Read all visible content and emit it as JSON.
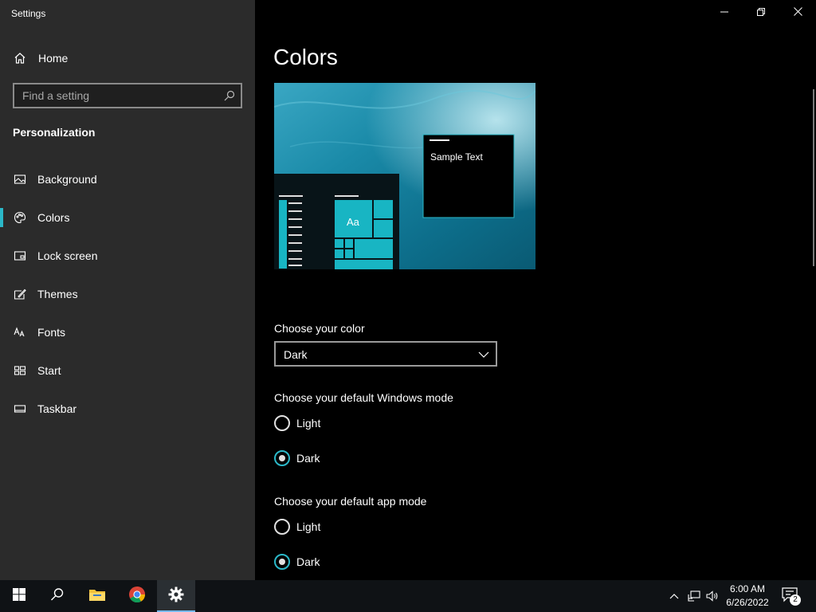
{
  "window": {
    "app_title": "Settings"
  },
  "sidebar": {
    "home_label": "Home",
    "search_placeholder": "Find a setting",
    "section_heading": "Personalization",
    "items": [
      {
        "label": "Background",
        "icon": "picture-icon"
      },
      {
        "label": "Colors",
        "icon": "palette-icon",
        "selected": true
      },
      {
        "label": "Lock screen",
        "icon": "lock-screen-icon"
      },
      {
        "label": "Themes",
        "icon": "themes-icon"
      },
      {
        "label": "Fonts",
        "icon": "fonts-icon"
      },
      {
        "label": "Start",
        "icon": "start-icon"
      },
      {
        "label": "Taskbar",
        "icon": "taskbar-icon"
      }
    ]
  },
  "main": {
    "page_title": "Colors",
    "preview": {
      "sample_text": "Sample Text",
      "tile_text": "Aa"
    },
    "choose_color": {
      "label": "Choose your color",
      "value": "Dark"
    },
    "windows_mode": {
      "label": "Choose your default Windows mode",
      "options": [
        "Light",
        "Dark"
      ],
      "selected": "Dark"
    },
    "app_mode": {
      "label": "Choose your default app mode",
      "options": [
        "Light",
        "Dark"
      ],
      "selected": "Dark"
    }
  },
  "taskbar": {
    "time": "6:00 AM",
    "date": "6/26/2022",
    "notification_count": "2"
  },
  "colors": {
    "accent": "#2bb8c8",
    "sidebar_bg": "#2b2b2b",
    "taskbar_bg": "#0f1215"
  }
}
